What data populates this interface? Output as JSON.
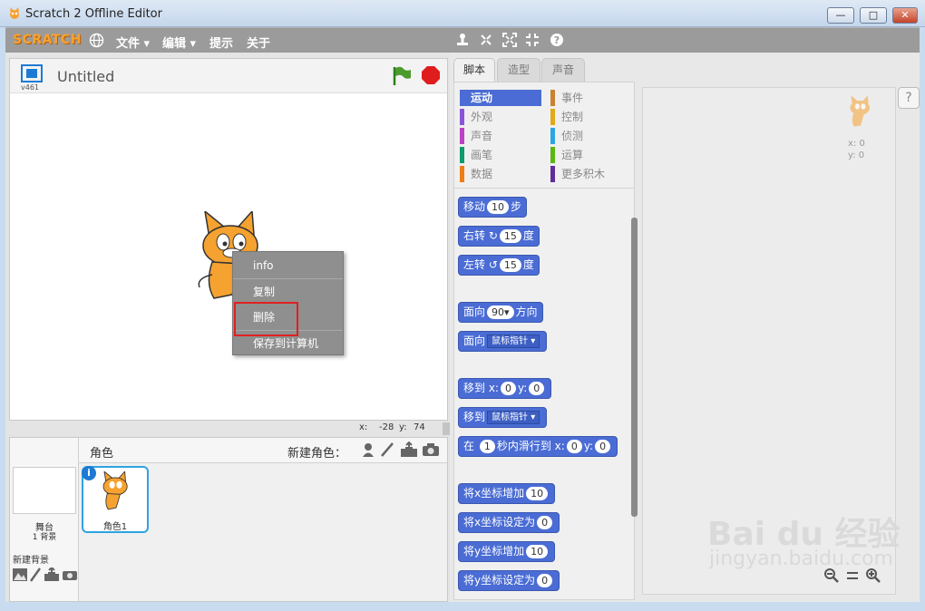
{
  "window": {
    "title": "Scratch 2 Offline Editor",
    "minimize": "—",
    "restore": "□",
    "close": "✕"
  },
  "menubar": {
    "logo": "SCRATCH",
    "items": [
      "文件 ▾",
      "编辑 ▾",
      "提示",
      "关于"
    ],
    "tool_icons": [
      "stamp-icon",
      "scissors-icon",
      "grow-icon",
      "shrink-icon",
      "help-icon"
    ]
  },
  "stage": {
    "title": "Untitled",
    "version": "v461",
    "x_label": "x:",
    "x_value": "-28",
    "y_label": "y:",
    "y_value": "74"
  },
  "context_menu": {
    "items": [
      "info",
      "复制",
      "删除",
      "保存到计算机"
    ],
    "highlighted": "删除"
  },
  "sprites": {
    "header": "角色",
    "new_sprite": "新建角色：",
    "stage_label": "舞台",
    "stage_backdrops": "1 背景",
    "new_backdrop": "新建背景",
    "sprite1": "角色1"
  },
  "tabs": [
    "脚本",
    "造型",
    "声音"
  ],
  "categories": [
    {
      "label": "运动",
      "color": "#4a6cd4",
      "selected": true
    },
    {
      "label": "事件",
      "color": "#c88330"
    },
    {
      "label": "外观",
      "color": "#8a55d7"
    },
    {
      "label": "控制",
      "color": "#e1a91a"
    },
    {
      "label": "声音",
      "color": "#bb42c3"
    },
    {
      "label": "侦测",
      "color": "#2ca5e2"
    },
    {
      "label": "画笔",
      "color": "#0e9a6c"
    },
    {
      "label": "运算",
      "color": "#5cb712"
    },
    {
      "label": "数据",
      "color": "#ee7d16"
    },
    {
      "label": "更多积木",
      "color": "#632d99"
    }
  ],
  "blocks": {
    "move": {
      "a": "移动",
      "v": "10",
      "b": "步"
    },
    "turn_right": {
      "a": "右转",
      "icon": "↻",
      "v": "15",
      "b": "度"
    },
    "turn_left": {
      "a": "左转",
      "icon": "↺",
      "v": "15",
      "b": "度"
    },
    "point_dir": {
      "a": "面向",
      "v": "90▾",
      "b": "方向"
    },
    "point_towards": {
      "a": "面向",
      "v": "鼠标指针 ▾"
    },
    "goto_xy": {
      "a": "移到 x:",
      "x": "0",
      "b": "y:",
      "y": "0"
    },
    "goto": {
      "a": "移到",
      "v": "鼠标指针 ▾"
    },
    "glide": {
      "a": "在",
      "t": "1",
      "b": "秒内滑行到 x:",
      "x": "0",
      "c": "y:",
      "y": "0"
    },
    "change_x": {
      "a": "将x坐标增加",
      "v": "10"
    },
    "set_x": {
      "a": "将x坐标设定为",
      "v": "0"
    },
    "change_y": {
      "a": "将y坐标增加",
      "v": "10"
    },
    "set_y": {
      "a": "将y坐标设定为",
      "v": "0"
    }
  },
  "script_area": {
    "x_label": "x: 0",
    "y_label": "y: 0",
    "help": "?"
  },
  "watermark": {
    "text": "Bai du 经验",
    "url": "jingyan.baidu.com"
  }
}
